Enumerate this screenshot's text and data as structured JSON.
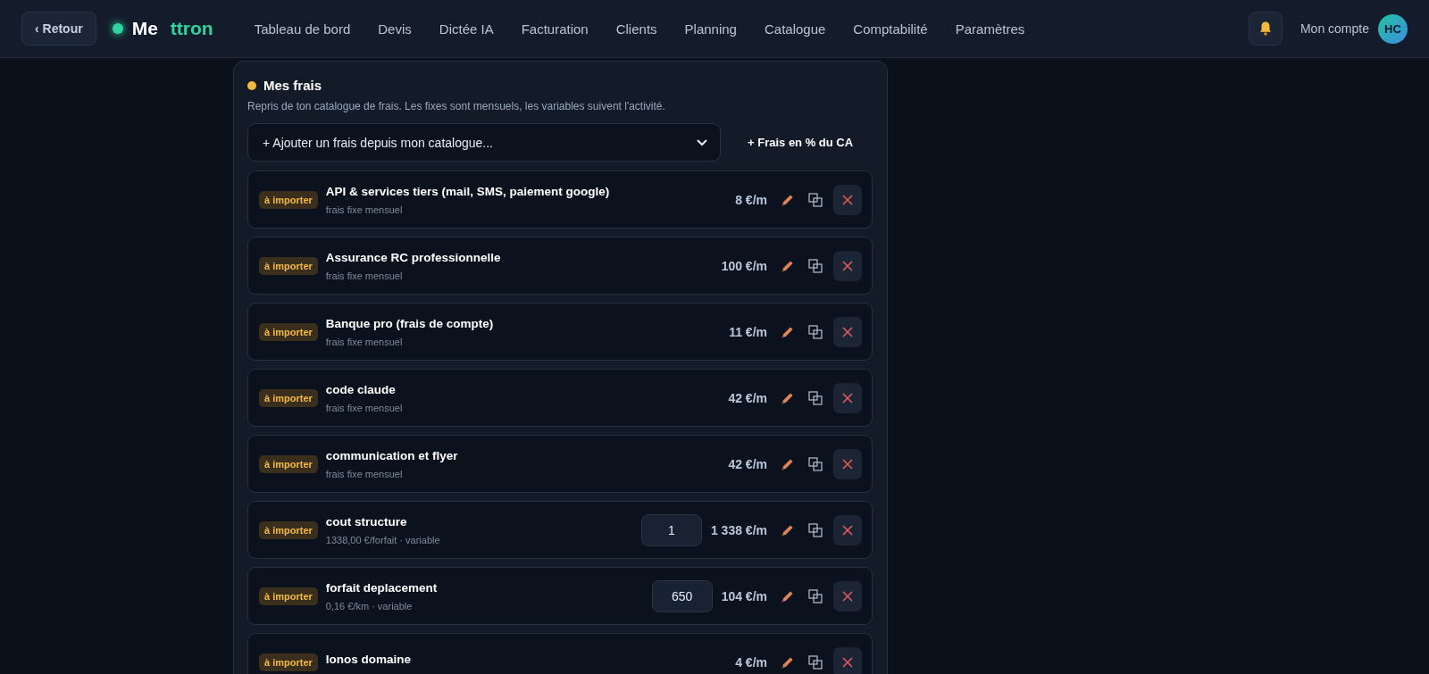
{
  "header": {
    "back": "‹ Retour",
    "logo": {
      "part_1": "Me",
      "part_2": "ttron"
    },
    "nav": [
      "Tableau de bord",
      "Devis",
      "Dictée IA",
      "Facturation",
      "Clients",
      "Planning",
      "Catalogue",
      "Comptabilité",
      "Paramètres"
    ],
    "account": "Mon compte",
    "avatar": "HC"
  },
  "section": {
    "title": "Mes frais",
    "description": "Repris de ton catalogue de frais. Les fixes sont mensuels, les variables suivent l'activité.",
    "select": "+ Ajouter un frais depuis mon catalogue...",
    "percent_button": "+ Frais en % du CA",
    "rows": [
      {
        "kind": "fixed",
        "badge": "à importer",
        "title": "API & services tiers (mail, SMS, paiement google)",
        "subtitle": "frais fixe mensuel",
        "amount": "8 €/m"
      },
      {
        "kind": "fixed",
        "badge": "à importer",
        "title": "Assurance RC professionnelle",
        "subtitle": "frais fixe mensuel",
        "amount": "100 €/m"
      },
      {
        "kind": "fixed",
        "badge": "à importer",
        "title": "Banque pro (frais de compte)",
        "subtitle": "frais fixe mensuel",
        "amount": "11 €/m"
      },
      {
        "kind": "fixed",
        "badge": "à importer",
        "title": "code claude",
        "subtitle": "frais fixe mensuel",
        "amount": "42 €/m"
      },
      {
        "kind": "fixed",
        "badge": "à importer",
        "title": "communication et flyer",
        "subtitle": "frais fixe mensuel",
        "amount": "42 €/m"
      },
      {
        "kind": "variable",
        "badge": "à importer",
        "title": "cout structure",
        "subtitle": "1338,00 €/forfait · variable",
        "quantity": "1",
        "amount": "1 338 €/m"
      },
      {
        "kind": "variable",
        "badge": "à importer",
        "title": "forfait deplacement",
        "subtitle": "0,16 €/km · variable",
        "quantity": "650",
        "amount": "104 €/m"
      },
      {
        "kind": "fixed",
        "badge": "à importer",
        "title": "Ionos domaine",
        "amount": "4 €/m"
      }
    ]
  }
}
